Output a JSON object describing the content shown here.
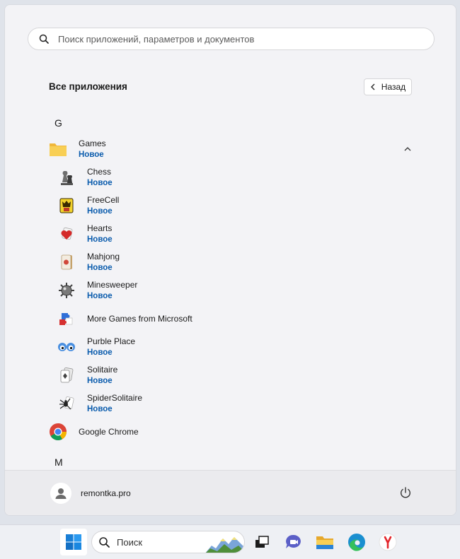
{
  "search": {
    "placeholder": "Поиск приложений, параметров и документов"
  },
  "all_apps": {
    "title": "Все приложения",
    "back_label": "Назад"
  },
  "letters": {
    "g": "G",
    "m": "M"
  },
  "apps": {
    "games_folder": {
      "name": "Games",
      "badge": "Новое"
    },
    "chess": {
      "name": "Chess",
      "badge": "Новое"
    },
    "freecell": {
      "name": "FreeCell",
      "badge": "Новое"
    },
    "hearts": {
      "name": "Hearts",
      "badge": "Новое"
    },
    "mahjong": {
      "name": "Mahjong",
      "badge": "Новое"
    },
    "minesweeper": {
      "name": "Minesweeper",
      "badge": "Новое"
    },
    "more_games": {
      "name": "More Games from Microsoft"
    },
    "purble_place": {
      "name": "Purble Place",
      "badge": "Новое"
    },
    "solitaire": {
      "name": "Solitaire",
      "badge": "Новое"
    },
    "spider_solitaire": {
      "name": "SpiderSolitaire",
      "badge": "Новое"
    },
    "chrome": {
      "name": "Google Chrome"
    }
  },
  "footer": {
    "user_name": "remontka.pro"
  },
  "taskbar": {
    "search_label": "Поиск"
  },
  "colors": {
    "accent_badge": "#0b5cad",
    "folder": "#f5c84c",
    "start_blue": "#1a7fd6"
  }
}
